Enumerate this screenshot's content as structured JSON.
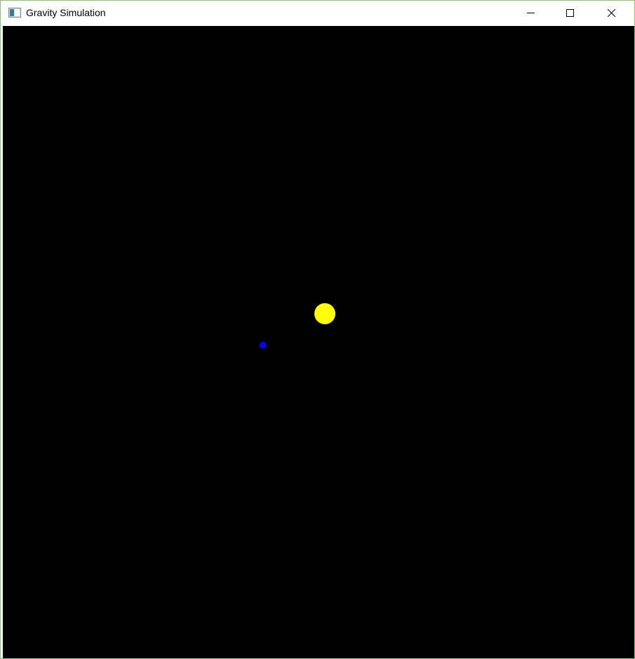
{
  "window": {
    "title": "Gravity Simulation",
    "controls": {
      "minimize": "minimize-icon",
      "maximize": "maximize-icon",
      "close": "close-icon"
    }
  },
  "simulation": {
    "background_color": "#000000",
    "bodies": [
      {
        "name": "sun",
        "color": "#ffff00"
      },
      {
        "name": "planet",
        "color": "#0000ff"
      }
    ]
  }
}
